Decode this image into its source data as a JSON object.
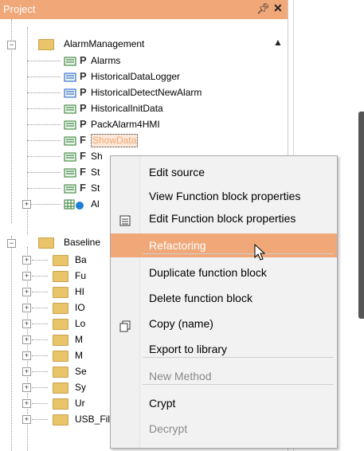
{
  "panel": {
    "title": "Project",
    "pin_glyph": "⇧",
    "close_glyph": "×"
  },
  "tree": {
    "root_label": "AlarmManagement",
    "children": [
      {
        "label": "Alarms",
        "icon": "program-icon",
        "code": "P"
      },
      {
        "label": "HistoricalDataLogger",
        "icon": "task-program-icon",
        "code": "P"
      },
      {
        "label": "HistoricalDetectNewAlarm",
        "icon": "task-program-icon",
        "code": "P"
      },
      {
        "label": "HistoricalInitData",
        "icon": "program-icon",
        "code": "P"
      },
      {
        "label": "PackAlarm4HMI",
        "icon": "program-icon",
        "code": "P"
      },
      {
        "label": "ShowData",
        "icon": "function-block-icon",
        "code": "F"
      },
      {
        "label": "Sh",
        "icon": "function-block-icon",
        "code": "F"
      },
      {
        "label": "St",
        "icon": "function-block-icon",
        "code": "F"
      },
      {
        "label": "St",
        "icon": "function-block-icon",
        "code": "F"
      },
      {
        "label": "Al",
        "icon": "grid-icon",
        "code": ""
      }
    ],
    "root2_label": "Baseline",
    "folders": [
      "Ba",
      "Fu",
      "HI",
      "IO",
      "Lo",
      "M",
      "M",
      "Se",
      "Sy",
      "Ur",
      "USB_FileSystem"
    ]
  },
  "context_menu": {
    "items": [
      {
        "label": "Edit source",
        "icon": "",
        "disabled": false
      },
      {
        "label": "View Function block properties",
        "icon": "",
        "disabled": false
      },
      {
        "label": "Edit Function block properties",
        "icon": "properties-icon",
        "disabled": false
      },
      {
        "label": "Refactoring",
        "icon": "",
        "disabled": false,
        "highlighted": true
      },
      {
        "label": "Duplicate function block",
        "icon": "",
        "disabled": false
      },
      {
        "label": "Delete function block",
        "icon": "",
        "disabled": false
      },
      {
        "label": "Copy (name)",
        "icon": "copy-icon",
        "disabled": false
      },
      {
        "label": "Export to library",
        "icon": "",
        "disabled": false
      },
      {
        "label": "New Method",
        "icon": "",
        "disabled": true
      },
      {
        "label": "Crypt",
        "icon": "",
        "disabled": false
      },
      {
        "label": "Decrypt",
        "icon": "",
        "disabled": true
      }
    ]
  },
  "colors": {
    "accent": "#f0a878",
    "folder": "#e8c46a",
    "selection_border": "#333333"
  }
}
